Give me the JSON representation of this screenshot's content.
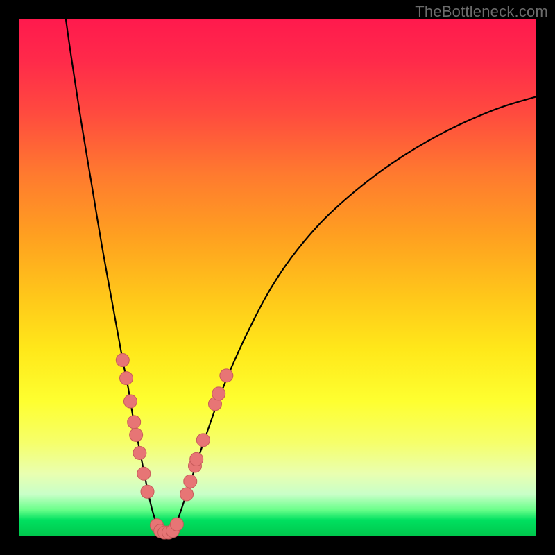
{
  "watermark": "TheBottleneck.com",
  "colors": {
    "curve": "#000000",
    "marker_fill": "#e77575",
    "marker_stroke": "#c85a5a",
    "background": "#000000"
  },
  "chart_data": {
    "type": "line",
    "title": "",
    "xlabel": "",
    "ylabel": "",
    "xlim": [
      0,
      100
    ],
    "ylim": [
      0,
      100
    ],
    "series": [
      {
        "name": "bottleneck-curve",
        "x": [
          9,
          10,
          12,
          14,
          16,
          18,
          20,
          21,
          22,
          23,
          24,
          25,
          26,
          27,
          28,
          29,
          30,
          31,
          33,
          36,
          40,
          45,
          50,
          56,
          63,
          72,
          82,
          92,
          100
        ],
        "y": [
          100,
          93,
          80,
          68,
          56,
          45,
          34,
          29,
          23,
          18,
          13,
          8,
          4,
          1.5,
          0.5,
          0.5,
          1.5,
          4,
          10,
          19,
          30,
          41,
          50,
          58,
          65,
          72,
          78,
          82.5,
          85
        ]
      }
    ],
    "markers": {
      "name": "highlighted-points",
      "points": [
        {
          "x": 20.0,
          "y": 34.0
        },
        {
          "x": 20.7,
          "y": 30.5
        },
        {
          "x": 21.5,
          "y": 26.0
        },
        {
          "x": 22.2,
          "y": 22.0
        },
        {
          "x": 22.6,
          "y": 19.5
        },
        {
          "x": 23.3,
          "y": 16.0
        },
        {
          "x": 24.1,
          "y": 12.0
        },
        {
          "x": 24.8,
          "y": 8.5
        },
        {
          "x": 26.6,
          "y": 2.0
        },
        {
          "x": 27.3,
          "y": 0.9
        },
        {
          "x": 28.1,
          "y": 0.6
        },
        {
          "x": 28.9,
          "y": 0.6
        },
        {
          "x": 29.7,
          "y": 0.9
        },
        {
          "x": 30.5,
          "y": 2.2
        },
        {
          "x": 32.4,
          "y": 8.0
        },
        {
          "x": 33.1,
          "y": 10.5
        },
        {
          "x": 34.0,
          "y": 13.5
        },
        {
          "x": 34.3,
          "y": 14.8
        },
        {
          "x": 35.6,
          "y": 18.5
        },
        {
          "x": 37.9,
          "y": 25.5
        },
        {
          "x": 38.6,
          "y": 27.5
        },
        {
          "x": 40.1,
          "y": 31.0
        }
      ]
    }
  }
}
